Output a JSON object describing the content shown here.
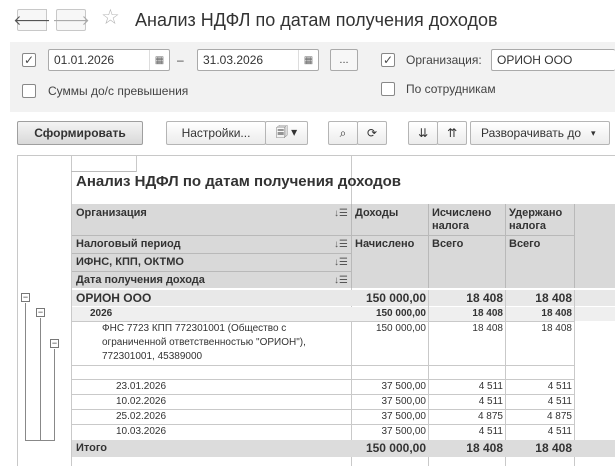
{
  "window": {
    "title": "Анализ НДФЛ по датам получения доходов"
  },
  "filters": {
    "date_from": "01.01.2026",
    "date_dash": "–",
    "date_to": "31.03.2026",
    "period_btn": "...",
    "org_label": "Организация:",
    "org_value": "ОРИОН ООО",
    "over_label": "Суммы до/с превышения",
    "by_employee_label": "По сотрудникам"
  },
  "toolbar": {
    "generate": "Сформировать",
    "settings": "Настройки...",
    "expand": "Разворачивать до"
  },
  "report": {
    "title": "Анализ НДФЛ по датам получения доходов",
    "headers": {
      "org": "Организация",
      "period": "Налоговый период",
      "ifns": "ИФНС, КПП, ОКТМО",
      "date": "Дата получения дохода",
      "income": "Доходы",
      "accrued": "Начислено",
      "calc": "Исчислено налога",
      "calc_total": "Всего",
      "withheld": "Удержано налога",
      "withheld_total": "Всего"
    },
    "org_row": {
      "name": "ОРИОН ООО",
      "income": "150 000,00",
      "calc": "18 408",
      "withheld": "18 408"
    },
    "year_row": {
      "name": "2026",
      "income": "150 000,00",
      "calc": "18 408",
      "withheld": "18 408"
    },
    "ifns_row": {
      "line1": "ФНС 7723 КПП 772301001 (Общество с",
      "line2": "ограниченной ответственностью \"ОРИОН\"),",
      "line3": "772301001, 45389000",
      "income": "150 000,00",
      "calc": "18 408",
      "withheld": "18 408"
    },
    "date_rows": [
      {
        "date": "23.01.2026",
        "income": "37 500,00",
        "calc": "4 511",
        "withheld": "4 511"
      },
      {
        "date": "10.02.2026",
        "income": "37 500,00",
        "calc": "4 511",
        "withheld": "4 511"
      },
      {
        "date": "25.02.2026",
        "income": "37 500,00",
        "calc": "4 875",
        "withheld": "4 875"
      },
      {
        "date": "10.03.2026",
        "income": "37 500,00",
        "calc": "4 511",
        "withheld": "4 511"
      }
    ],
    "total_row": {
      "label": "Итого",
      "income": "150 000,00",
      "calc": "18 408",
      "withheld": "18 408"
    }
  }
}
